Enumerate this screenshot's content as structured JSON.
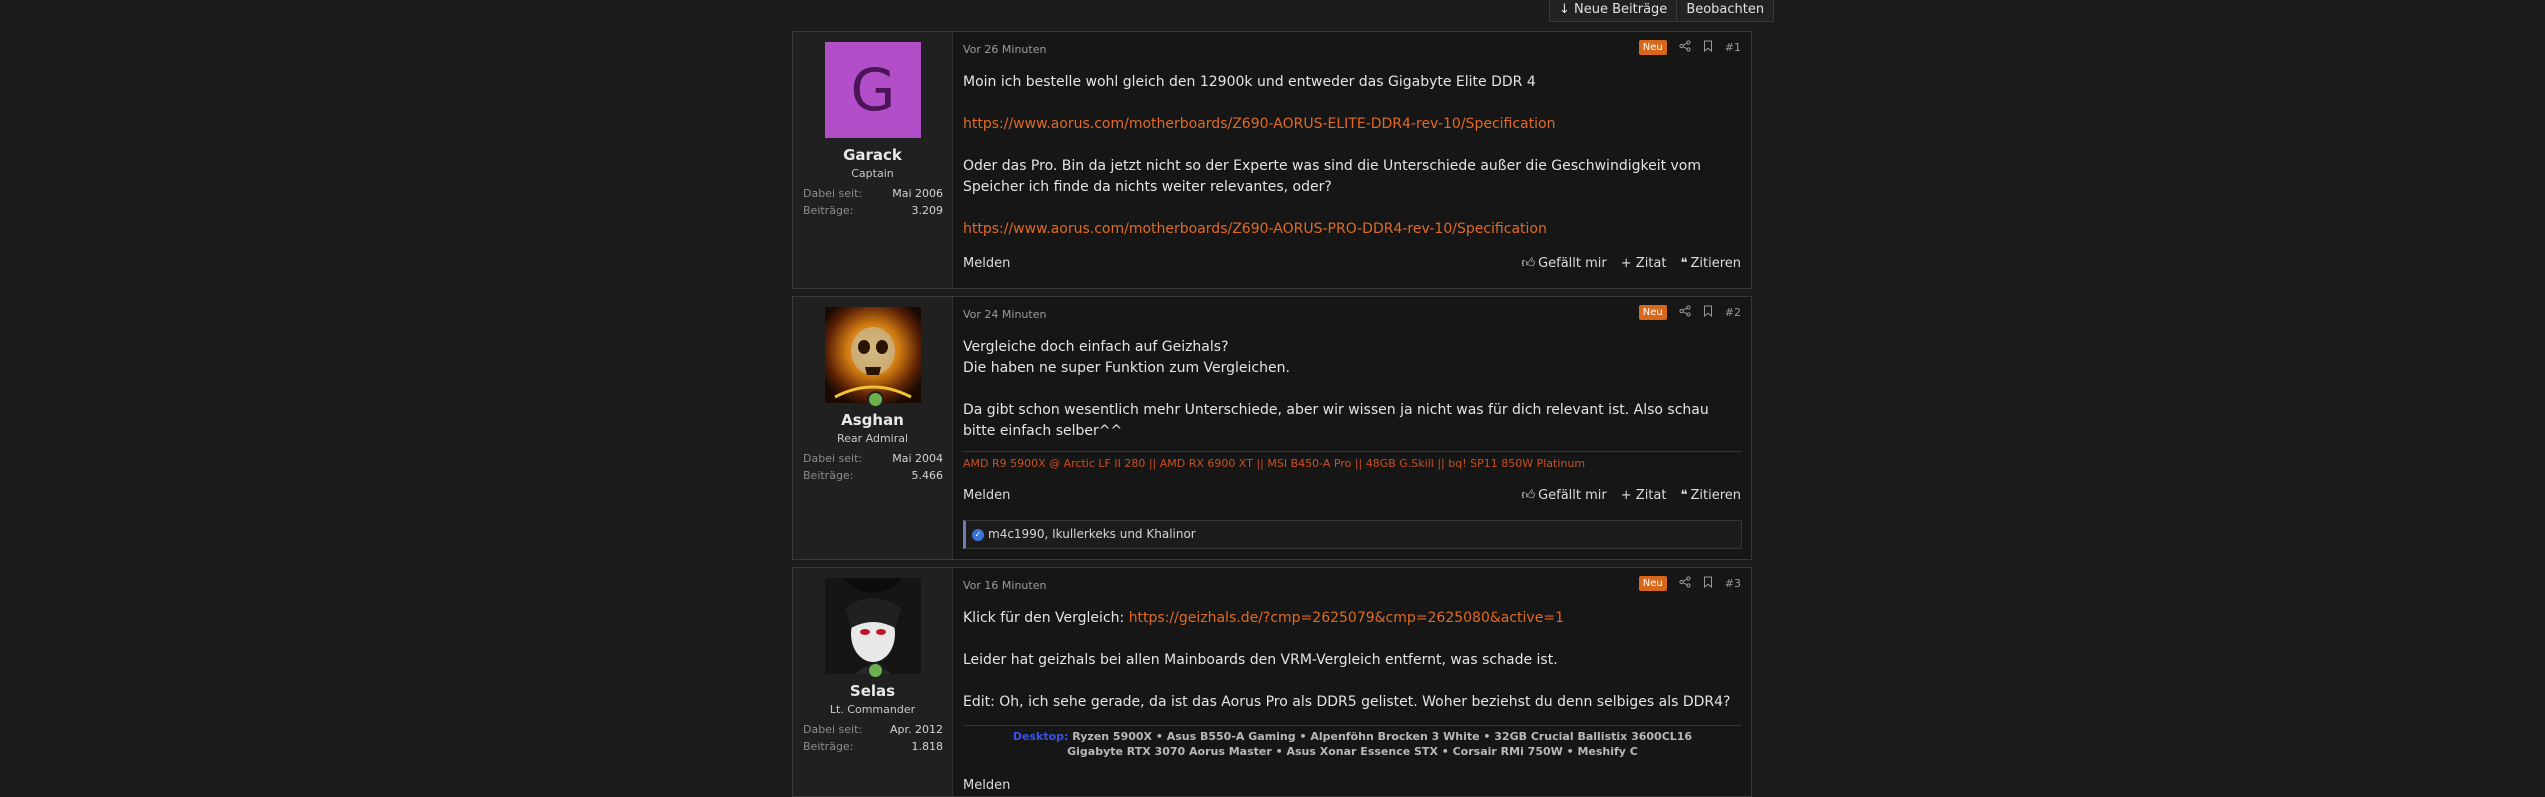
{
  "thread_actions": {
    "new_posts": "↓ Neue Beiträge",
    "watch": "Beobachten"
  },
  "colors": {
    "accent": "#e06a24",
    "new_badge": "#d7671b",
    "avatar_garack": "#b24fc8"
  },
  "labels": {
    "member_since": "Dabei seit:",
    "posts": "Beiträge:",
    "report": "Melden",
    "like": "Gefällt mir",
    "quote_plus": "+ Zitat",
    "quote": "Zitieren",
    "new": "Neu"
  },
  "posts": [
    {
      "avatar_letter": "G",
      "username": "Garack",
      "title": "Captain",
      "member_since": "Mai 2006",
      "post_count": "3.209",
      "time": "Vor 26 Minuten",
      "number": "#1",
      "lines": [
        "Moin ich bestelle wohl gleich den 12900k und entweder das Gigabyte Elite DDR 4",
        "https://www.aorus.com/motherboards/Z690-AORUS-ELITE-DDR4-rev-10/Specification",
        "Oder das Pro. Bin da jetzt nicht so der Experte was sind die Unterschiede außer die Geschwindigkeit vom Speicher ich finde da nichts weiter relevantes, oder?",
        "https://www.aorus.com/motherboards/Z690-AORUS-PRO-DDR4-rev-10/Specification"
      ]
    },
    {
      "username": "Asghan",
      "title": "Rear Admiral",
      "member_since": "Mai 2004",
      "post_count": "5.466",
      "time": "Vor 24 Minuten",
      "number": "#2",
      "lines": [
        "Vergleiche doch einfach auf Geizhals?",
        "Die haben ne super Funktion zum Vergleichen.",
        "Da gibt schon wesentlich mehr Unterschiede, aber wir wissen ja nicht was für dich relevant ist. Also schau bitte einfach selber^^"
      ],
      "signature": "AMD R9 5900X @ Arctic LF II 280 || AMD RX 6900 XT || MSI B450-A Pro || 48GB G.Skill || bq! SP11 850W Platinum",
      "reactions": "m4c1990, Ikullerkeks und Khalinor"
    },
    {
      "username": "Selas",
      "title": "Lt. Commander",
      "member_since": "Apr. 2012",
      "post_count": "1.818",
      "time": "Vor 16 Minuten",
      "number": "#3",
      "lines": [
        "Klick für den Vergleich: ",
        "https://geizhals.de/?cmp=2625079&cmp=2625080&active=1",
        "Leider hat geizhals bei allen Mainboards den VRM-Vergleich entfernt, was schade ist.",
        "Edit: Oh, ich sehe gerade, da ist das Aorus Pro als DDR5 gelistet. Woher beziehst du denn selbiges als DDR4?"
      ],
      "signature_label": "Desktop:",
      "signature_1": " Ryzen 5900X • Asus B550-A Gaming • Alpenföhn Brocken 3 White • 32GB Crucial Ballistix 3600CL16",
      "signature_2": "Gigabyte RTX 3070 Aorus Master • Asus Xonar Essence STX • Corsair RMi 750W • Meshify C"
    }
  ]
}
